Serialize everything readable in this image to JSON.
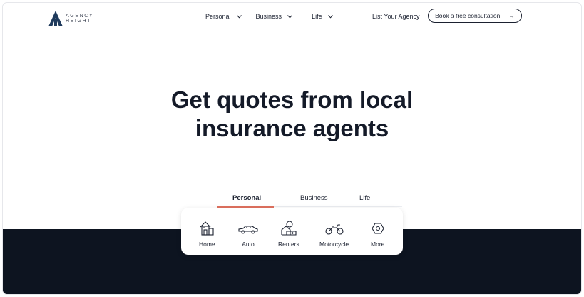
{
  "brand": {
    "line1": "AGENCY",
    "line2": "HEIGHT"
  },
  "nav": {
    "items": [
      {
        "label": "Personal"
      },
      {
        "label": "Business"
      },
      {
        "label": "Life"
      }
    ],
    "list_agency": "List Your Agency",
    "cta": "Book a free consultation",
    "cta_arrow": "→"
  },
  "hero": {
    "title_line1": "Get quotes from local",
    "title_line2": "insurance agents"
  },
  "tabs": [
    {
      "label": "Personal",
      "active": true
    },
    {
      "label": "Business",
      "active": false
    },
    {
      "label": "Life",
      "active": false
    }
  ],
  "products": [
    {
      "label": "Home",
      "icon": "home-icon"
    },
    {
      "label": "Auto",
      "icon": "car-icon"
    },
    {
      "label": "Renters",
      "icon": "renters-icon"
    },
    {
      "label": "Motorcycle",
      "icon": "motorcycle-icon"
    },
    {
      "label": "More",
      "icon": "more-icon"
    }
  ],
  "colors": {
    "accent": "#e0715f",
    "dark_band": "#0d1420",
    "text": "#14171f"
  }
}
